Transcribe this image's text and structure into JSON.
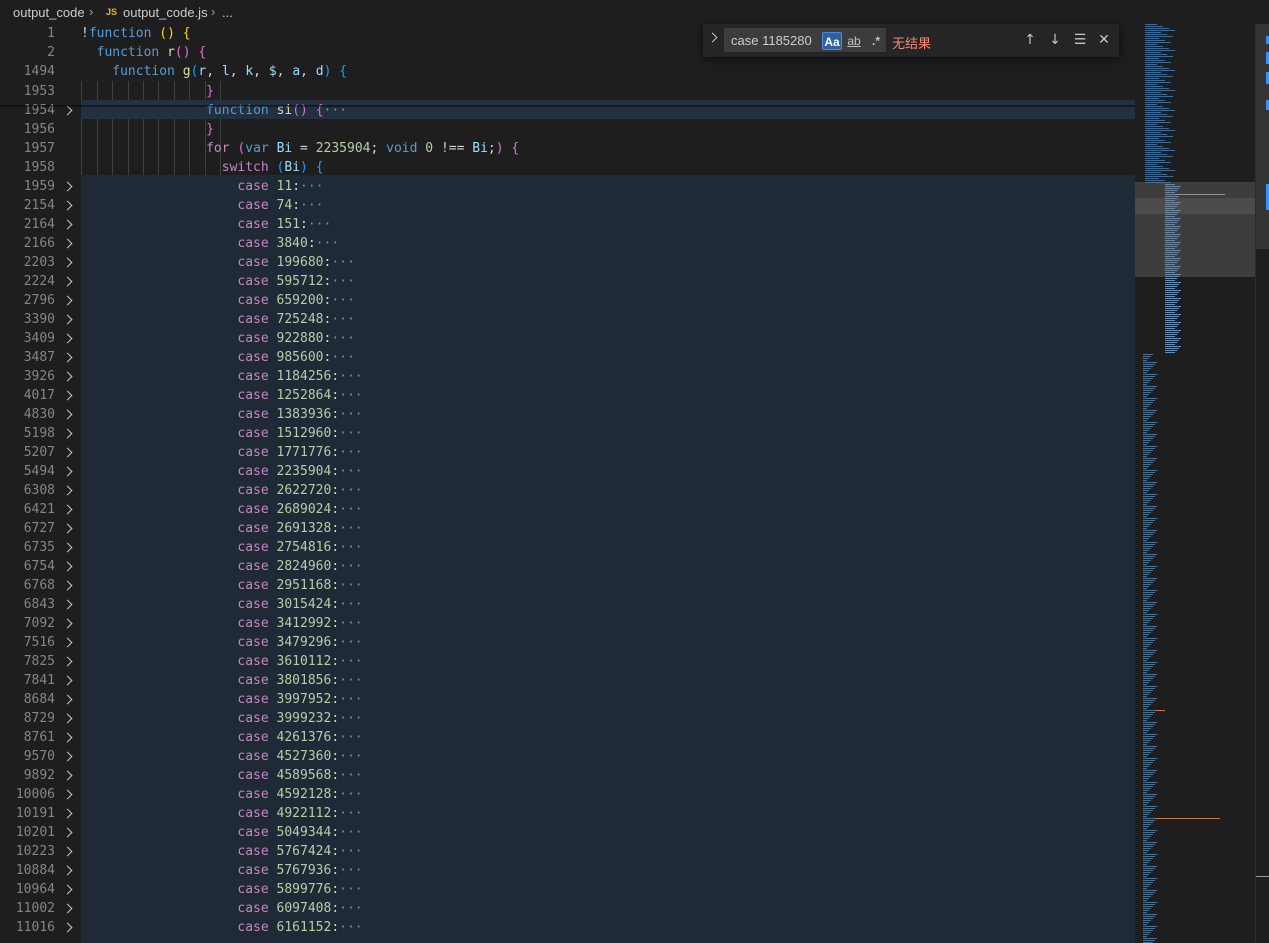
{
  "breadcrumb": {
    "folder": "output_code",
    "file_badge": "JS",
    "file": "output_code.js",
    "tail": "..."
  },
  "find": {
    "query": "case 1185280",
    "match_case_label": "Aa",
    "whole_word_label": "ab",
    "regex_label": ".*",
    "result": "无结果",
    "match_case_active": true
  },
  "colors": {
    "keyword": "#569cd6",
    "control": "#c586c0",
    "function": "#dcdcaa",
    "number": "#b5cea8",
    "variable": "#9cdcfe",
    "no_result": "#f48771"
  },
  "sticky_lines": [
    {
      "num": "1",
      "text": "!function () {"
    },
    {
      "num": "2",
      "text": "function r() {"
    },
    {
      "num": "1494",
      "text": "function g(r, l, k, $, a, d) {"
    }
  ],
  "lines": [
    {
      "num": "1953",
      "text": "}"
    },
    {
      "num": "1954",
      "text": "function si() {···"
    },
    {
      "num": "1956",
      "text": "}"
    },
    {
      "num": "1957",
      "text": "for (var Bi = 2235904; void 0 !== Bi;) {"
    },
    {
      "num": "1958",
      "text": "switch (Bi) {"
    }
  ],
  "case_lines": [
    {
      "num": "1959",
      "value": "11"
    },
    {
      "num": "2154",
      "value": "74"
    },
    {
      "num": "2164",
      "value": "151"
    },
    {
      "num": "2166",
      "value": "3840"
    },
    {
      "num": "2203",
      "value": "199680"
    },
    {
      "num": "2224",
      "value": "595712"
    },
    {
      "num": "2796",
      "value": "659200"
    },
    {
      "num": "3390",
      "value": "725248"
    },
    {
      "num": "3409",
      "value": "922880"
    },
    {
      "num": "3487",
      "value": "985600"
    },
    {
      "num": "3926",
      "value": "1184256"
    },
    {
      "num": "4017",
      "value": "1252864"
    },
    {
      "num": "4830",
      "value": "1383936"
    },
    {
      "num": "5198",
      "value": "1512960"
    },
    {
      "num": "5207",
      "value": "1771776"
    },
    {
      "num": "5494",
      "value": "2235904"
    },
    {
      "num": "6308",
      "value": "2622720"
    },
    {
      "num": "6421",
      "value": "2689024"
    },
    {
      "num": "6727",
      "value": "2691328"
    },
    {
      "num": "6735",
      "value": "2754816"
    },
    {
      "num": "6754",
      "value": "2824960"
    },
    {
      "num": "6768",
      "value": "2951168"
    },
    {
      "num": "6843",
      "value": "3015424"
    },
    {
      "num": "7092",
      "value": "3412992"
    },
    {
      "num": "7516",
      "value": "3479296"
    },
    {
      "num": "7825",
      "value": "3610112"
    },
    {
      "num": "7841",
      "value": "3801856"
    },
    {
      "num": "8684",
      "value": "3997952"
    },
    {
      "num": "8729",
      "value": "3999232"
    },
    {
      "num": "8761",
      "value": "4261376"
    },
    {
      "num": "9570",
      "value": "4527360"
    },
    {
      "num": "9892",
      "value": "4589568"
    },
    {
      "num": "10006",
      "value": "4592128"
    },
    {
      "num": "10191",
      "value": "4922112"
    },
    {
      "num": "10201",
      "value": "5049344"
    },
    {
      "num": "10223",
      "value": "5767424"
    },
    {
      "num": "10884",
      "value": "5767936"
    },
    {
      "num": "10964",
      "value": "5899776"
    },
    {
      "num": "11002",
      "value": "6097408"
    },
    {
      "num": "11016",
      "value": "6161152"
    }
  ],
  "case_keyword": "case"
}
